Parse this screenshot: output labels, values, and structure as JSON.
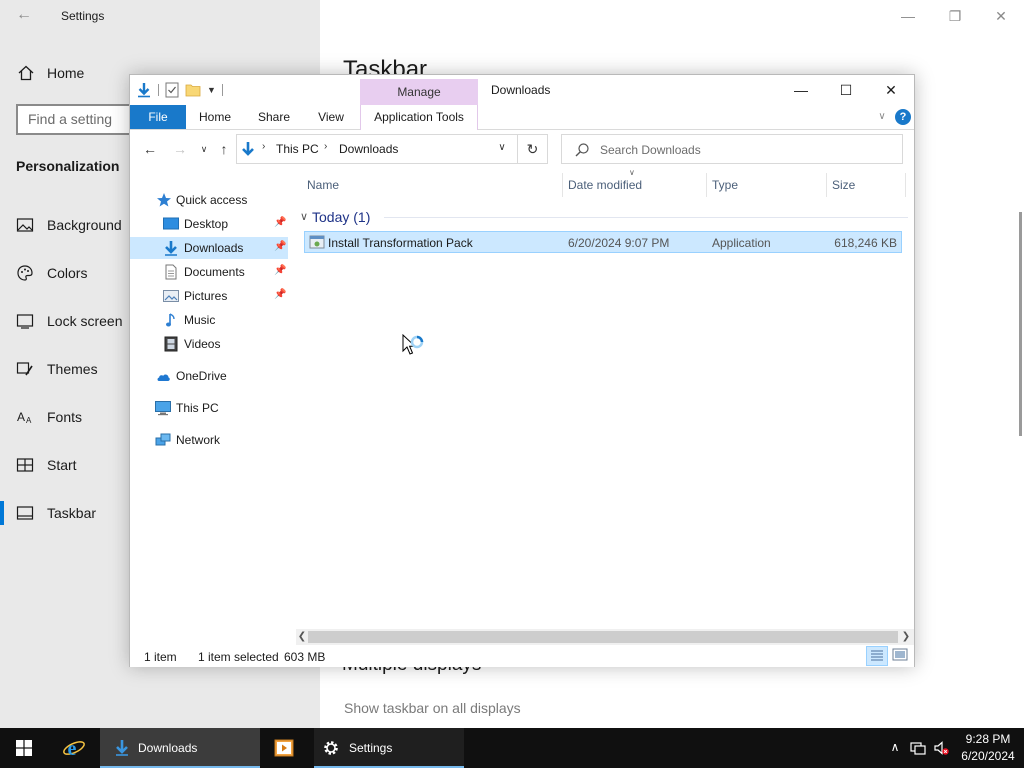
{
  "settings": {
    "window_title": "Settings",
    "home_label": "Home",
    "search_placeholder": "Find a setting",
    "section_title": "Personalization",
    "nav": [
      {
        "label": "Background",
        "icon": "picture-icon"
      },
      {
        "label": "Colors",
        "icon": "palette-icon"
      },
      {
        "label": "Lock screen",
        "icon": "lock-screen-icon"
      },
      {
        "label": "Themes",
        "icon": "brush-icon"
      },
      {
        "label": "Fonts",
        "icon": "font-icon"
      },
      {
        "label": "Start",
        "icon": "start-grid-icon"
      },
      {
        "label": "Taskbar",
        "icon": "taskbar-icon",
        "active": true
      }
    ],
    "page_heading": "Taskbar",
    "multiple_displays_heading": "Multiple displays",
    "show_all_displays_label": "Show taskbar on all displays"
  },
  "explorer": {
    "window_title": "Downloads",
    "contextual_group": "Manage",
    "ribbon_tabs": {
      "file": "File",
      "home": "Home",
      "share": "Share",
      "view": "View",
      "app_tools": "Application Tools"
    },
    "help_label": "?",
    "address": {
      "segments": [
        "This PC",
        "Downloads"
      ]
    },
    "search_placeholder": "Search Downloads",
    "nav_pane": {
      "quick_access": "Quick access",
      "items": [
        {
          "label": "Desktop",
          "pinned": true
        },
        {
          "label": "Downloads",
          "pinned": true,
          "selected": true
        },
        {
          "label": "Documents",
          "pinned": true
        },
        {
          "label": "Pictures",
          "pinned": true
        },
        {
          "label": "Music",
          "pinned": false
        },
        {
          "label": "Videos",
          "pinned": false
        }
      ],
      "onedrive": "OneDrive",
      "this_pc": "This PC",
      "network": "Network"
    },
    "columns": {
      "name": "Name",
      "date_modified": "Date modified",
      "type": "Type",
      "size": "Size"
    },
    "group_label": "Today (1)",
    "files": [
      {
        "name": "Install Transformation Pack",
        "date_modified": "6/20/2024 9:07 PM",
        "type": "Application",
        "size": "618,246 KB",
        "selected": true
      }
    ],
    "status": {
      "item_count": "1 item",
      "selection": "1 item selected",
      "selection_size": "603 MB"
    }
  },
  "taskbar": {
    "buttons": [
      {
        "label": "Downloads",
        "icon": "downloads-folder-icon"
      },
      {
        "label": "Settings",
        "icon": "gear-icon"
      }
    ],
    "clock_time": "9:28 PM",
    "clock_date": "6/20/2024"
  },
  "colors": {
    "accent": "#0078d7",
    "file_tab": "#1979ca",
    "selection": "#cce8ff",
    "manage_tab": "#e8cef0",
    "taskbar": "#101010"
  }
}
